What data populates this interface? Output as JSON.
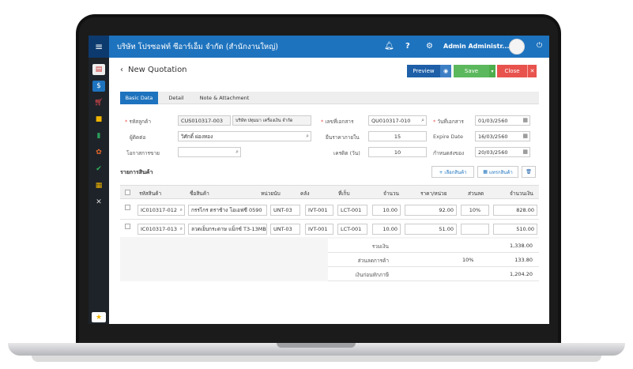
{
  "header": {
    "company": "บริษัท โปรซอฟท์ ซีอาร์เอ็ม จำกัด (สำนักงานใหญ่)",
    "user_name": "Admin Administr...",
    "help": "?",
    "menu_icon": "hamburger-icon",
    "bell_icon": "bell-icon",
    "gear_icon": "gear-icon",
    "power_icon": "power-icon"
  },
  "sidebar": {
    "items": [
      "presentation-icon",
      "money-icon",
      "cart-icon",
      "box-icon",
      "book-icon",
      "gear-people-icon",
      "check-circle-icon",
      "document-icon",
      "tools-icon"
    ],
    "star": "★"
  },
  "page": {
    "title": "New Quotation",
    "back": "‹",
    "preview": "Preview",
    "save": "Save",
    "close": "Close",
    "close_x": "✕",
    "caret": "▾",
    "eye": "◉"
  },
  "tabs": [
    "Basic Data",
    "Detail",
    "Note & Attachment"
  ],
  "form": {
    "customer_label": "รหัสลูกค้า",
    "customer_code": "CUS010317-003",
    "customer_name": "บริษัท ปทุมมา เครื่องเงิน จำกัด",
    "contact_label": "ผู้ติดต่อ",
    "contact_value": "วิศักดิ์ ผ่องทอง",
    "opportunity_label": "โอกาสการขาย",
    "opportunity_value": "",
    "doc_no_label": "เลขที่เอกสาร",
    "doc_no_value": "QU010317-010",
    "price_valid_label": "ยืนราคาภายใน",
    "price_valid_value": "15",
    "credit_label": "เครดิต (วัน)",
    "credit_value": "10",
    "doc_date_label": "วันที่เอกสาร",
    "doc_date_value": "01/03/2560",
    "expire_label": "Expire Date",
    "expire_value": "16/03/2560",
    "delivery_label": "กำหนดส่งของ",
    "delivery_value": "20/03/2560"
  },
  "items_section": {
    "title": "รายการสินค้า",
    "add_button": "+ เลือกสินค้า",
    "insert_button": "แทรกสินค้า",
    "delete_icon": "trash-icon"
  },
  "table": {
    "headers": [
      "รหัสสินค้า",
      "ชื่อสินค้า",
      "หน่วยนับ",
      "คลัง",
      "ที่เก็บ",
      "จำนวน",
      "ราคา/หน่วย",
      "ส่วนลด",
      "จำนวนเงิน"
    ],
    "rows": [
      {
        "code": "IC010317-012",
        "name": "กรรไกร ตราช้าง โอเอฟซี 0590",
        "unit": "UNT-03",
        "warehouse": "IVT-001",
        "location": "LCT-001",
        "qty": "10.00",
        "price": "92.00",
        "discount": "10%",
        "amount": "828.00"
      },
      {
        "code": "IC010317-013",
        "name": "ลวดเย็บกระดาษ แม็กซ์ T3-13MB",
        "unit": "UNT-03",
        "warehouse": "IVT-001",
        "location": "LCT-001",
        "qty": "10.00",
        "price": "51.00",
        "discount": "",
        "amount": "510.00"
      }
    ]
  },
  "summary": {
    "subtotal_label": "รวมเงิน",
    "subtotal_value": "1,338.00",
    "discount_label": "ส่วนลดการค้า",
    "discount_pct": "10%",
    "discount_value": "133.80",
    "before_tax_label": "เงินก่อนหักภาษี",
    "before_tax_value": "1,204.20"
  }
}
